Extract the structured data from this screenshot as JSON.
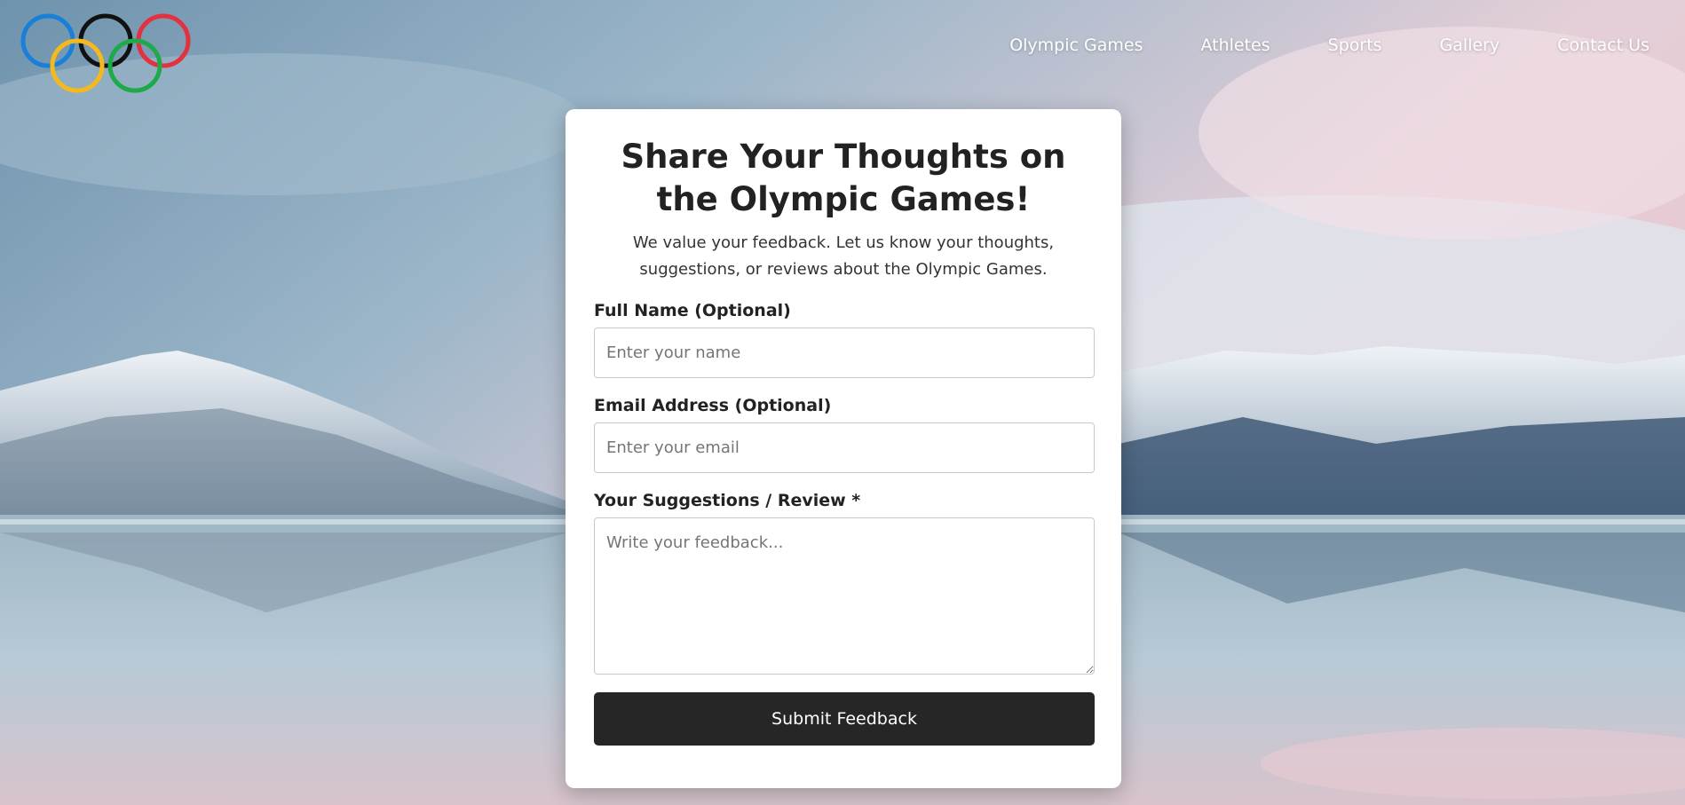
{
  "colors": {
    "ring_blue": "#1a7fd6",
    "ring_black": "#111111",
    "ring_red": "#e3323f",
    "ring_yellow": "#f5b91e",
    "ring_green": "#1faa4a",
    "button_bg": "#262626"
  },
  "logo": {
    "icon": "olympic-rings-icon"
  },
  "nav": {
    "items": [
      "Olympic Games",
      "Athletes",
      "Sports",
      "Gallery",
      "Contact Us"
    ]
  },
  "form": {
    "title": "Share Your Thoughts on the Olympic Games!",
    "intro": "We value your feedback. Let us know your thoughts, suggestions, or reviews about the Olympic Games.",
    "name_label": "Full Name (Optional)",
    "name_placeholder": "Enter your name",
    "name_value": "",
    "email_label": "Email Address (Optional)",
    "email_placeholder": "Enter your email",
    "email_value": "",
    "feedback_label": "Your Suggestions / Review *",
    "feedback_placeholder": "Write your feedback...",
    "feedback_value": "",
    "submit_label": "Submit Feedback"
  }
}
